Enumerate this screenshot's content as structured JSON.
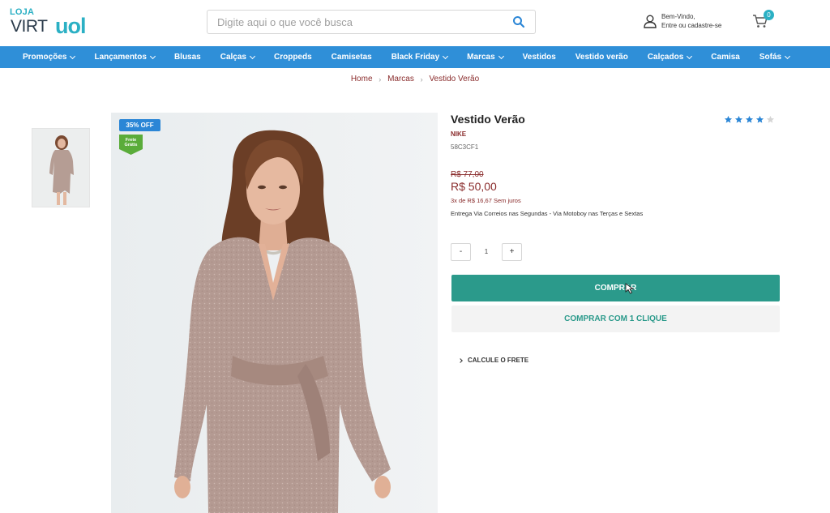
{
  "header": {
    "logo": {
      "top": "LOJA",
      "left": "VIRT",
      "right": "uol"
    },
    "search_placeholder": "Digite aqui o que você busca",
    "account": {
      "line1": "Bem-Vindo,",
      "line2": "Entre ou cadastre-se"
    },
    "cart_count": "0"
  },
  "nav": {
    "items": [
      {
        "label": "Promoções",
        "has_dropdown": true
      },
      {
        "label": "Lançamentos",
        "has_dropdown": true
      },
      {
        "label": "Blusas",
        "has_dropdown": false
      },
      {
        "label": "Calças",
        "has_dropdown": true
      },
      {
        "label": "Croppeds",
        "has_dropdown": false
      },
      {
        "label": "Camisetas",
        "has_dropdown": false
      },
      {
        "label": "Black Friday",
        "has_dropdown": true
      },
      {
        "label": "Marcas",
        "has_dropdown": true
      },
      {
        "label": "Vestidos",
        "has_dropdown": false
      },
      {
        "label": "Vestido verão",
        "has_dropdown": false
      },
      {
        "label": "Calçados",
        "has_dropdown": true
      },
      {
        "label": "Camisa",
        "has_dropdown": false
      },
      {
        "label": "Sofás",
        "has_dropdown": true
      }
    ]
  },
  "breadcrumb": {
    "home": "Home",
    "sep": "›",
    "category": "Marcas",
    "current": "Vestido Verão"
  },
  "badges": {
    "discount": "35% OFF",
    "free_shipping_line1": "Frete",
    "free_shipping_line2": "Grátis"
  },
  "product": {
    "title": "Vestido Verão",
    "brand": "NIKE",
    "sku": "58C3CF1",
    "rating": 4,
    "rating_max": 5,
    "old_price": "R$ 77,00",
    "price": "R$ 50,00",
    "installments": "3x de R$ 16,67 Sem juros",
    "shipping_info": "Entrega Via Correios nas Segundas - Via Motoboy nas Terças e Sextas",
    "quantity": "1",
    "qty_minus": "-",
    "qty_plus": "+",
    "buy_label": "COMPRAR",
    "one_click_label": "COMPRAR COM 1 CLIQUE",
    "freight_label": "CALCULE O FRETE"
  },
  "colors": {
    "accent": "#2bb0c4",
    "nav_bg": "#2f8fd8",
    "buy_button": "#2b9a8b",
    "price": "#8a2c2c",
    "star_on": "#2b86d6",
    "star_off": "#d5d5d5"
  }
}
